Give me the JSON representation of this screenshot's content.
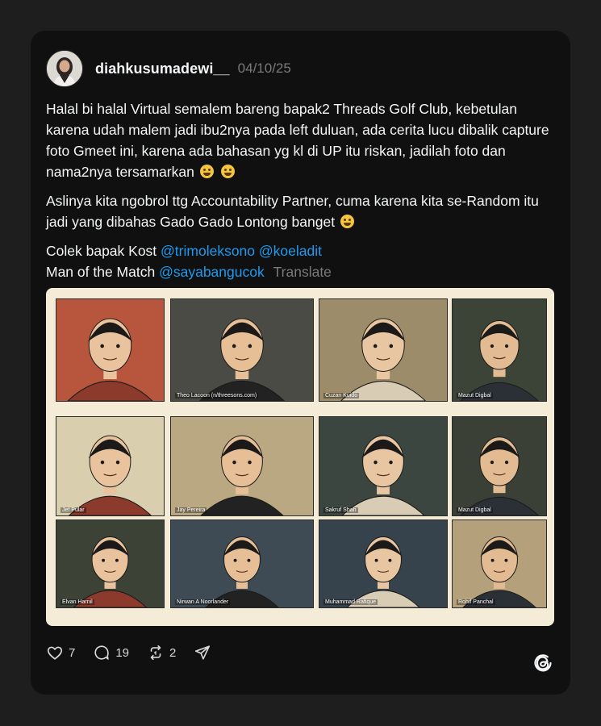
{
  "post": {
    "username": "diahkusumadewi__",
    "date": "04/10/25",
    "paragraph1": "Halal bi halal Virtual semalem bareng bapak2 Threads Golf Club, kebetulan karena udah malem jadi ibu2nya pada left duluan, ada cerita lucu dibalik capture foto Gmeet ini, karena ada bahasan yg kl di UP itu riskan, jadilah foto dan nama2nya tersamarkan",
    "paragraph2": "Aslinya kita ngobrol ttg Accountability Partner, cuma karena kita se-Random itu jadi yang dibahas Gado Gado Lontong banget",
    "line3_prefix": "Colek bapak Kost",
    "mention1": "@trimoleksono",
    "mention2": "@koeladit",
    "line4_prefix": "Man of the Match",
    "mention3": "@sayabangucok",
    "translate": "Translate"
  },
  "tiles": [
    {
      "name": "",
      "bg": "#b8553d"
    },
    {
      "name": "Theo Lacoon (n/threesons.com)",
      "bg": "#4b4b45"
    },
    {
      "name": "Cuzan Kuido",
      "bg": "#9c8c6a"
    },
    {
      "name": "Mazut Digbal",
      "bg": "#3c4438"
    },
    {
      "name": "Jef Pular",
      "bg": "#d9cfae"
    },
    {
      "name": "Jay Pereira",
      "bg": "#b9a882"
    },
    {
      "name": "Sakruf Shah",
      "bg": "#3b4640"
    },
    {
      "name": "Mazut Digbal",
      "bg": "#3a4036"
    },
    {
      "name": "Elvan Harnil",
      "bg": "#3d4236"
    },
    {
      "name": "Nirwan A Noorlander",
      "bg": "#3e4a54"
    },
    {
      "name": "Muhammad Rafique",
      "bg": "#37434c"
    },
    {
      "name": "Rohif Panchal",
      "bg": "#b4a07a"
    }
  ],
  "actions": {
    "likes": "7",
    "comments": "19",
    "reposts": "2"
  },
  "icons": [
    "heart-icon",
    "comment-icon",
    "repost-icon",
    "share-icon",
    "threads-logo-icon"
  ]
}
